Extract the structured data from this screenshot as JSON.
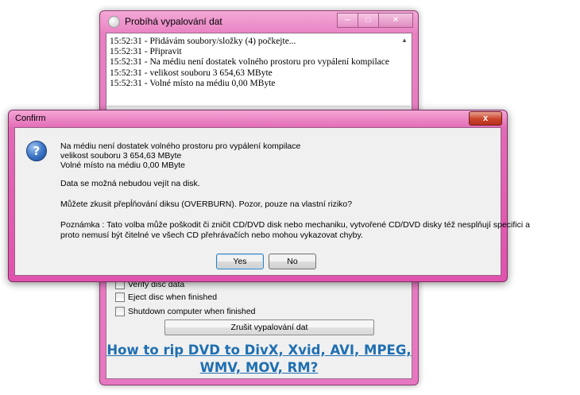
{
  "burn_window": {
    "title": "Probíhá vypalování dat",
    "log": [
      "15:52:31 - Přidávám soubory/složky (4) počkejte...",
      "15:52:31 - Připravit",
      "15:52:31 - Na médiu není dostatek volného prostoru pro vypálení kompilace",
      "15:52:31 - velikost souboru 3 654,63 MByte",
      "15:52:31 - Volné místo na médiu 0,00 MByte"
    ],
    "checkbox_partial": "Verify disc data",
    "checkbox_eject": "Eject disc when finished",
    "checkbox_shutdown": "Shutdown computer when finished",
    "stop_button": "Zrušit vypalování dat",
    "promo_line1": "How to rip DVD to DivX, Xvid, AVI, MPEG,",
    "promo_line2": "WMV, MOV, RM?"
  },
  "confirm": {
    "title": "Confirm",
    "close_glyph": "x",
    "icon_glyph": "?",
    "lines": [
      "Na médiu není dostatek volného prostoru pro vypálení kompilace",
      "velikost souboru 3 654,63 MByte",
      "Volné místo na médiu 0,00 MByte",
      "Data se možná nebudou vejít na disk.",
      "Můžete zkusit přepĺňování diksu (OVERBURN). Pozor, pouze na vlastní riziko?",
      "Poznámka : Tato volba může poškodit či zničit CD/DVD disk nebo mechaniku, vytvořené CD/DVD disky též nesplňují specifici a",
      "proto nemusí být čitelné ve všech CD přehrávačích nebo mohou vykazovat chyby."
    ],
    "yes_label": "Yes",
    "no_label": "No"
  }
}
